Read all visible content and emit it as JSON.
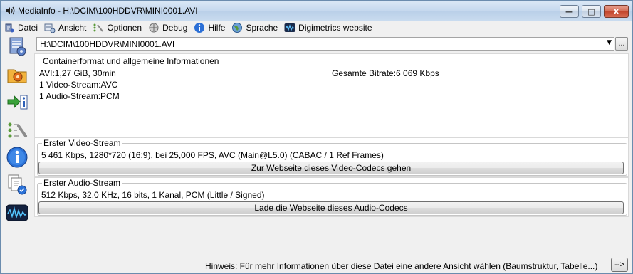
{
  "window": {
    "title": "MediaInfo - H:\\DCIM\\100HDDVR\\MINI0001.AVI",
    "minimize": "—",
    "maximize": "□",
    "close": "X"
  },
  "menu": [
    {
      "label": "Datei",
      "icon": "file-icon"
    },
    {
      "label": "Ansicht",
      "icon": "view-icon"
    },
    {
      "label": "Optionen",
      "icon": "options-icon"
    },
    {
      "label": "Debug",
      "icon": "debug-icon"
    },
    {
      "label": "Hilfe",
      "icon": "help-icon"
    },
    {
      "label": "Sprache",
      "icon": "language-icon"
    },
    {
      "label": "Digimetrics website",
      "icon": "digimetrics-icon"
    }
  ],
  "file": {
    "path": "H:\\DCIM\\100HDDVR\\MINI0001.AVI",
    "browse_label": "..."
  },
  "general": {
    "title": "Containerformat und allgemeine Informationen",
    "format_line": "AVI:1,27 GiB, 30min",
    "bitrate_line": "Gesamte Bitrate:6 069 Kbps",
    "video_count": "1 Video-Stream:AVC",
    "audio_count": "1 Audio-Stream:PCM"
  },
  "video": {
    "title": "Erster Video-Stream",
    "details": "5 461 Kbps, 1280*720 (16:9), bei 25,000 FPS, AVC (Main@L5.0) (CABAC / 1 Ref Frames)",
    "button": "Zur Webseite dieses Video-Codecs gehen"
  },
  "audio": {
    "title": "Erster Audio-Stream",
    "details": "512 Kbps, 32,0 KHz, 16 bits, 1 Kanal, PCM (Little / Signed)",
    "button": "Lade die Webseite dieses Audio-Codecs"
  },
  "footer": {
    "hint": "Hinweis: Für mehr Informationen über diese Datei eine andere Ansicht wählen (Baumstruktur, Tabelle...)",
    "more_button": "-->"
  }
}
